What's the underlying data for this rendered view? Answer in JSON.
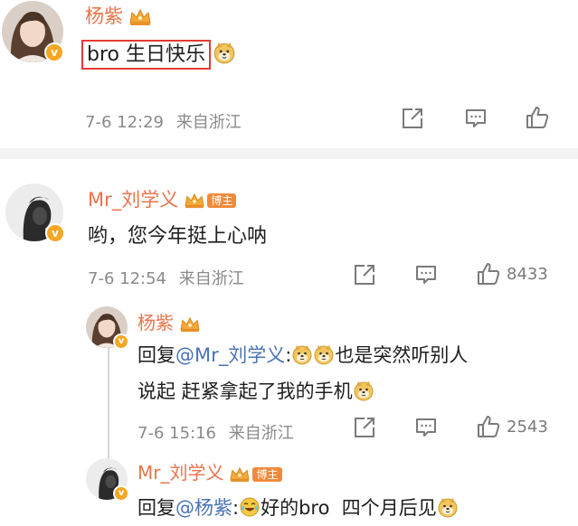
{
  "comments": [
    {
      "user": "杨紫",
      "text": "bro 生日快乐",
      "time": "7-6 12:29",
      "location": "来自浙江",
      "likes": ""
    },
    {
      "user": "Mr_刘学义",
      "badge": "博主",
      "text": "哟，您今年挺上心呐",
      "time": "7-6 12:54",
      "location": "来自浙江",
      "likes": "8433"
    }
  ],
  "replies": [
    {
      "user": "杨紫",
      "prefix": "回复",
      "mention": "@Mr_刘学义",
      "colon": ":",
      "text_line1_after": "也是突然听别人",
      "text_line2": "说起 赶紧拿起了我的手机",
      "time": "7-6 15:16",
      "location": "来自浙江",
      "likes": "2543"
    },
    {
      "user": "Mr_刘学义",
      "badge": "博主",
      "prefix": "回复",
      "mention": "@杨紫",
      "colon": ":",
      "text_after": "好的bro  四个月后见"
    }
  ],
  "icons": {
    "share": "share-icon",
    "comment": "comment-icon",
    "like": "like-icon",
    "crown": "crown-icon",
    "verified": "verified-icon",
    "emoji_doge": "doge-emoji",
    "emoji_laugh": "laugh-emoji"
  },
  "colors": {
    "username": "#e8744a",
    "mention": "#4a73b5",
    "highlight_box": "#e53935",
    "verified": "#f5a623"
  }
}
